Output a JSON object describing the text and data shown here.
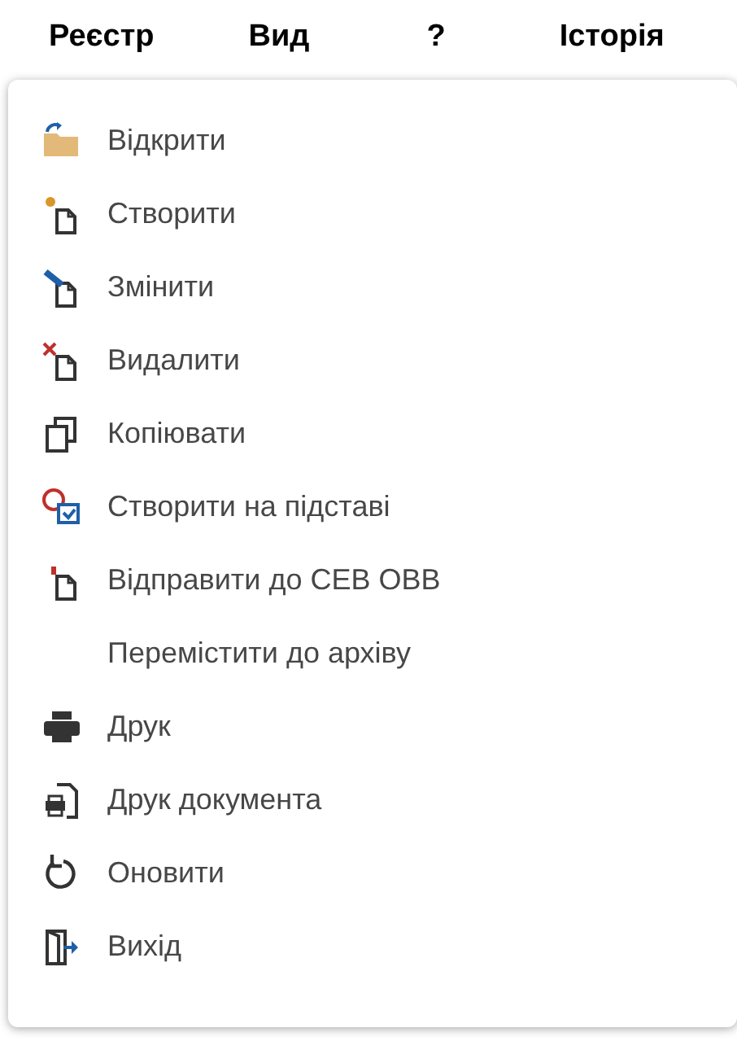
{
  "menu_bar": [
    {
      "label": "Реєстр"
    },
    {
      "label": "Вид"
    },
    {
      "label": "?"
    },
    {
      "label": "Історія"
    }
  ],
  "dropdown": {
    "items": [
      {
        "label": "Відкрити",
        "kind": "open"
      },
      {
        "label": "Створити",
        "kind": "create"
      },
      {
        "label": "Змінити",
        "kind": "edit"
      },
      {
        "label": "Видалити",
        "kind": "delete"
      },
      {
        "label": "Копіювати",
        "kind": "copy"
      },
      {
        "label": "Створити на підставі",
        "kind": "create-based"
      },
      {
        "label": "Відправити до СЕВ ОВВ",
        "kind": "send"
      },
      {
        "label": "Перемістити до архіву",
        "kind": "none"
      },
      {
        "label": "Друк",
        "kind": "print"
      },
      {
        "label": "Друк документа",
        "kind": "print-document"
      },
      {
        "label": "Оновити",
        "kind": "refresh"
      },
      {
        "label": "Вихід",
        "kind": "exit"
      }
    ]
  }
}
